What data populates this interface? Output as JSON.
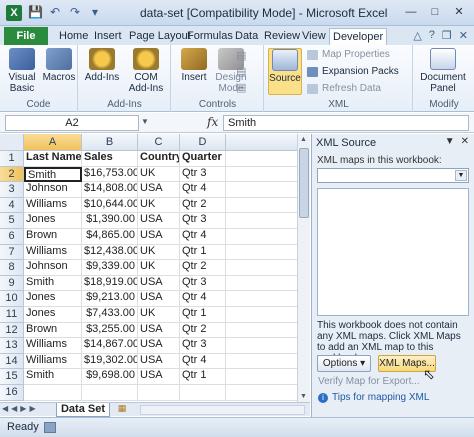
{
  "titlebar": {
    "app_logo": "X",
    "title": "data-set  [Compatibility Mode]  -  Microsoft Excel",
    "qat_icons": [
      "save-icon",
      "undo-icon",
      "redo-icon",
      "customize-icon"
    ]
  },
  "ribbon_tabs": {
    "file": "File",
    "tabs": [
      "Home",
      "Insert",
      "Page Layout",
      "Formulas",
      "Data",
      "Review",
      "View",
      "Developer"
    ],
    "active": "Developer"
  },
  "ribbon": {
    "code": {
      "label": "Code",
      "visual_basic": "Visual Basic",
      "macros": "Macros"
    },
    "addins": {
      "label": "Add-Ins",
      "addins": "Add-Ins",
      "com_addins": "COM Add-Ins"
    },
    "controls": {
      "label": "Controls",
      "insert": "Insert",
      "design_mode": "Design Mode"
    },
    "xml": {
      "label": "XML",
      "source": "Source",
      "map_properties": "Map Properties",
      "expansion_packs": "Expansion Packs",
      "refresh_data": "Refresh Data"
    },
    "modify": {
      "label": "Modify",
      "document_panel": "Document Panel"
    }
  },
  "formula_bar": {
    "name_box": "A2",
    "fx": "fx",
    "value": "Smith"
  },
  "sheet": {
    "columns": [
      "A",
      "B",
      "C",
      "D"
    ],
    "rows": [
      {
        "n": "1",
        "cells": [
          "Last Name",
          "Sales",
          "Country",
          "Quarter"
        ]
      },
      {
        "n": "2",
        "cells": [
          "Smith",
          "$16,753.00",
          "UK",
          "Qtr 3"
        ]
      },
      {
        "n": "3",
        "cells": [
          "Johnson",
          "$14,808.00",
          "USA",
          "Qtr 4"
        ]
      },
      {
        "n": "4",
        "cells": [
          "Williams",
          "$10,644.00",
          "UK",
          "Qtr 2"
        ]
      },
      {
        "n": "5",
        "cells": [
          "Jones",
          "$1,390.00",
          "USA",
          "Qtr 3"
        ]
      },
      {
        "n": "6",
        "cells": [
          "Brown",
          "$4,865.00",
          "USA",
          "Qtr 4"
        ]
      },
      {
        "n": "7",
        "cells": [
          "Williams",
          "$12,438.00",
          "UK",
          "Qtr 1"
        ]
      },
      {
        "n": "8",
        "cells": [
          "Johnson",
          "$9,339.00",
          "UK",
          "Qtr 2"
        ]
      },
      {
        "n": "9",
        "cells": [
          "Smith",
          "$18,919.00",
          "USA",
          "Qtr 3"
        ]
      },
      {
        "n": "10",
        "cells": [
          "Jones",
          "$9,213.00",
          "USA",
          "Qtr 4"
        ]
      },
      {
        "n": "11",
        "cells": [
          "Jones",
          "$7,433.00",
          "UK",
          "Qtr 1"
        ]
      },
      {
        "n": "12",
        "cells": [
          "Brown",
          "$3,255.00",
          "USA",
          "Qtr 2"
        ]
      },
      {
        "n": "13",
        "cells": [
          "Williams",
          "$14,867.00",
          "USA",
          "Qtr 3"
        ]
      },
      {
        "n": "14",
        "cells": [
          "Williams",
          "$19,302.00",
          "USA",
          "Qtr 4"
        ]
      },
      {
        "n": "15",
        "cells": [
          "Smith",
          "$9,698.00",
          "USA",
          "Qtr 1"
        ]
      },
      {
        "n": "16",
        "cells": [
          "",
          "",
          "",
          ""
        ]
      }
    ],
    "sheet_tab": "Data Set"
  },
  "status": {
    "text": "Ready"
  },
  "xml_pane": {
    "title": "XML Source",
    "maps_label": "XML maps in this workbook:",
    "message": "This workbook does not contain any XML maps. Click XML Maps to add an XML map to this workbook.",
    "options_btn": "Options",
    "xml_maps_btn": "XML Maps...",
    "verify": "Verify Map for Export...",
    "tips": "Tips for mapping XML"
  }
}
